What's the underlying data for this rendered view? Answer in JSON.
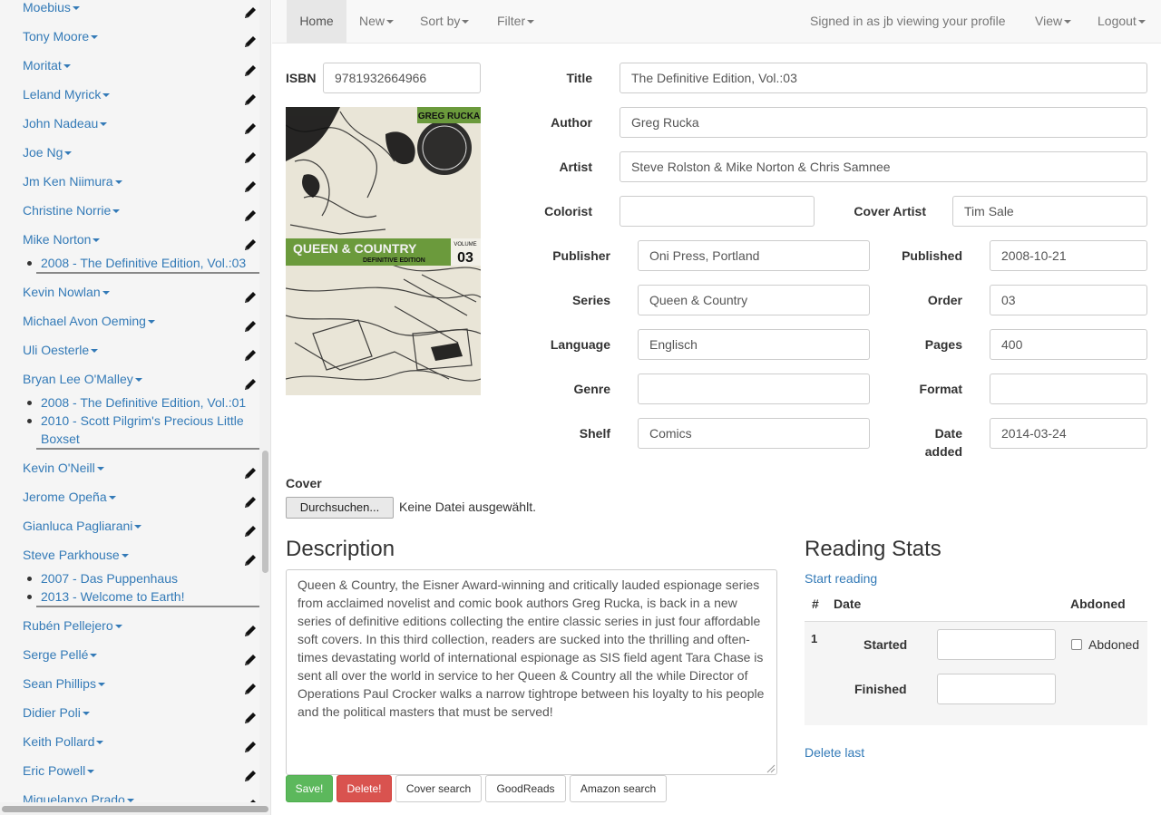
{
  "sidebar": {
    "authors": [
      {
        "name": "Moebius",
        "books": []
      },
      {
        "name": "Tony Moore",
        "books": []
      },
      {
        "name": "Moritat",
        "books": []
      },
      {
        "name": "Leland Myrick",
        "books": []
      },
      {
        "name": "John Nadeau",
        "books": []
      },
      {
        "name": "Joe Ng",
        "books": []
      },
      {
        "name": "Jm Ken Niimura",
        "books": []
      },
      {
        "name": "Christine Norrie",
        "books": []
      },
      {
        "name": "Mike Norton",
        "books": [
          "2008 - The Definitive Edition, Vol.:03"
        ]
      },
      {
        "name": "Kevin Nowlan",
        "books": []
      },
      {
        "name": "Michael Avon Oeming",
        "books": []
      },
      {
        "name": "Uli Oesterle",
        "books": []
      },
      {
        "name": "Bryan Lee O'Malley",
        "books": [
          "2008 - The Definitive Edition, Vol.:01",
          "2010 - Scott Pilgrim's Precious Little Boxset"
        ]
      },
      {
        "name": "Kevin O'Neill",
        "books": []
      },
      {
        "name": "Jerome Opeña",
        "books": []
      },
      {
        "name": "Gianluca Pagliarani",
        "books": []
      },
      {
        "name": "Steve Parkhouse",
        "books": [
          "2007 - Das Puppenhaus",
          "2013 - Welcome to Earth!"
        ]
      },
      {
        "name": "Rubén Pellejero",
        "books": []
      },
      {
        "name": "Serge Pellé",
        "books": []
      },
      {
        "name": "Sean Phillips",
        "books": []
      },
      {
        "name": "Didier Poli",
        "books": []
      },
      {
        "name": "Keith Pollard",
        "books": []
      },
      {
        "name": "Eric Powell",
        "books": []
      },
      {
        "name": "Miguelanxo Prado",
        "books": []
      }
    ]
  },
  "navbar": {
    "home": "Home",
    "new": "New",
    "sort_by": "Sort by",
    "filter": "Filter",
    "signed_in": "Signed in as jb viewing your profile",
    "view": "View",
    "logout": "Logout"
  },
  "form": {
    "isbn_label": "ISBN",
    "isbn": "9781932664966",
    "title_label": "Title",
    "title": "The Definitive Edition, Vol.:03",
    "author_label": "Author",
    "author": "Greg Rucka",
    "artist_label": "Artist",
    "artist": "Steve Rolston & Mike Norton & Chris Samnee",
    "colorist_label": "Colorist",
    "colorist": "",
    "cover_artist_label": "Cover Artist",
    "cover_artist": "Tim Sale",
    "publisher_label": "Publisher",
    "publisher": "Oni Press, Portland",
    "published_label": "Published",
    "published": "2008-10-21",
    "series_label": "Series",
    "series": "Queen & Country",
    "order_label": "Order",
    "order": "03",
    "language_label": "Language",
    "language": "Englisch",
    "pages_label": "Pages",
    "pages": "400",
    "genre_label": "Genre",
    "genre": "",
    "format_label": "Format",
    "format": "",
    "shelf_label": "Shelf",
    "shelf": "Comics",
    "date_added_label_1": "Date",
    "date_added_label_2": "added",
    "date_added": "2014-03-24",
    "cover_label": "Cover",
    "browse_button": "Durchsuchen...",
    "no_file": "Keine Datei ausgewählt."
  },
  "cover_art": {
    "author": "GREG RUCKA",
    "title": "QUEEN & COUNTRY",
    "subtitle": "DEFINITIVE EDITION",
    "volume_label": "VOLUME",
    "volume": "03"
  },
  "description": {
    "heading": "Description",
    "text": "Queen & Country, the Eisner Award-winning and critically lauded espionage series from acclaimed novelist and comic book authors Greg Rucka, is back in a new series of definitive editions collecting the entire classic series in just four affordable soft covers. In this third collection, readers are sucked into the thrilling and often-times devastating world of international espionage as SIS field agent Tara Chase is sent all over the world in service to her Queen & Country all the while Director of Operations Paul Crocker walks a narrow tightrope between his loyalty to his people and the political masters that must be served!"
  },
  "actions": {
    "save": "Save!",
    "delete": "Delete!",
    "cover_search": "Cover search",
    "goodreads": "GoodReads",
    "amazon": "Amazon search"
  },
  "stats": {
    "heading": "Reading Stats",
    "start_reading": "Start reading",
    "col_num": "#",
    "col_date": "Date",
    "col_abdoned": "Abdoned",
    "row_num": "1",
    "started_label": "Started",
    "finished_label": "Finished",
    "started": "",
    "finished": "",
    "abdoned_label": "Abdoned",
    "delete_last": "Delete last"
  },
  "colors": {
    "link": "#337ab7",
    "save": "#5cb85c",
    "delete": "#d9534f",
    "cover_band": "#6b9a3c"
  }
}
